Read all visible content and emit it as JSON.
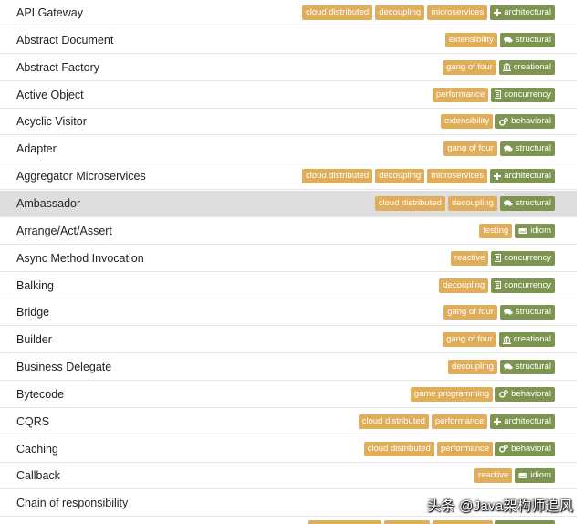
{
  "colors": {
    "keyword_tag": "#e0ae5a",
    "category_tag": "#7d9550",
    "highlight_row": "#dedede",
    "divider": "#e6e6e6"
  },
  "patterns": [
    {
      "title": "API Gateway",
      "keywords": [
        "cloud distributed",
        "decoupling",
        "microservices"
      ],
      "category": {
        "label": "architectural",
        "icon": "plus-icon"
      }
    },
    {
      "title": "Abstract Document",
      "keywords": [
        "extensibility"
      ],
      "category": {
        "label": "structural",
        "icon": "comments-icon"
      }
    },
    {
      "title": "Abstract Factory",
      "keywords": [
        "gang of four"
      ],
      "category": {
        "label": "creational",
        "icon": "building-icon"
      }
    },
    {
      "title": "Active Object",
      "keywords": [
        "performance"
      ],
      "category": {
        "label": "concurrency",
        "icon": "document-icon"
      }
    },
    {
      "title": "Acyclic Visitor",
      "keywords": [
        "extensibility"
      ],
      "category": {
        "label": "behavioral",
        "icon": "gears-icon"
      }
    },
    {
      "title": "Adapter",
      "keywords": [
        "gang of four"
      ],
      "category": {
        "label": "structural",
        "icon": "comments-icon"
      }
    },
    {
      "title": "Aggregator Microservices",
      "keywords": [
        "cloud distributed",
        "decoupling",
        "microservices"
      ],
      "category": {
        "label": "architectural",
        "icon": "plus-icon"
      }
    },
    {
      "title": "Ambassador",
      "keywords": [
        "cloud distributed",
        "decoupling"
      ],
      "category": {
        "label": "structural",
        "icon": "comments-icon"
      },
      "highlighted": true
    },
    {
      "title": "Arrange/Act/Assert",
      "keywords": [
        "testing"
      ],
      "category": {
        "label": "idiom",
        "icon": "hdd-icon"
      }
    },
    {
      "title": "Async Method Invocation",
      "keywords": [
        "reactive"
      ],
      "category": {
        "label": "concurrency",
        "icon": "document-icon"
      }
    },
    {
      "title": "Balking",
      "keywords": [
        "decoupling"
      ],
      "category": {
        "label": "concurrency",
        "icon": "document-icon"
      }
    },
    {
      "title": "Bridge",
      "keywords": [
        "gang of four"
      ],
      "category": {
        "label": "structural",
        "icon": "comments-icon"
      }
    },
    {
      "title": "Builder",
      "keywords": [
        "gang of four"
      ],
      "category": {
        "label": "creational",
        "icon": "building-icon"
      }
    },
    {
      "title": "Business Delegate",
      "keywords": [
        "decoupling"
      ],
      "category": {
        "label": "structural",
        "icon": "comments-icon"
      }
    },
    {
      "title": "Bytecode",
      "keywords": [
        "game programming"
      ],
      "category": {
        "label": "behavioral",
        "icon": "gears-icon"
      }
    },
    {
      "title": "CQRS",
      "keywords": [
        "cloud distributed",
        "performance"
      ],
      "category": {
        "label": "architectural",
        "icon": "plus-icon"
      }
    },
    {
      "title": "Caching",
      "keywords": [
        "cloud distributed",
        "performance"
      ],
      "category": {
        "label": "behavioral",
        "icon": "gears-icon"
      }
    },
    {
      "title": "Callback",
      "keywords": [
        "reactive"
      ],
      "category": {
        "label": "idiom",
        "icon": "hdd-icon"
      }
    },
    {
      "title": "Chain of responsibility",
      "keywords": [],
      "category": null
    }
  ],
  "watermark": "头条 @Java架构师追风"
}
